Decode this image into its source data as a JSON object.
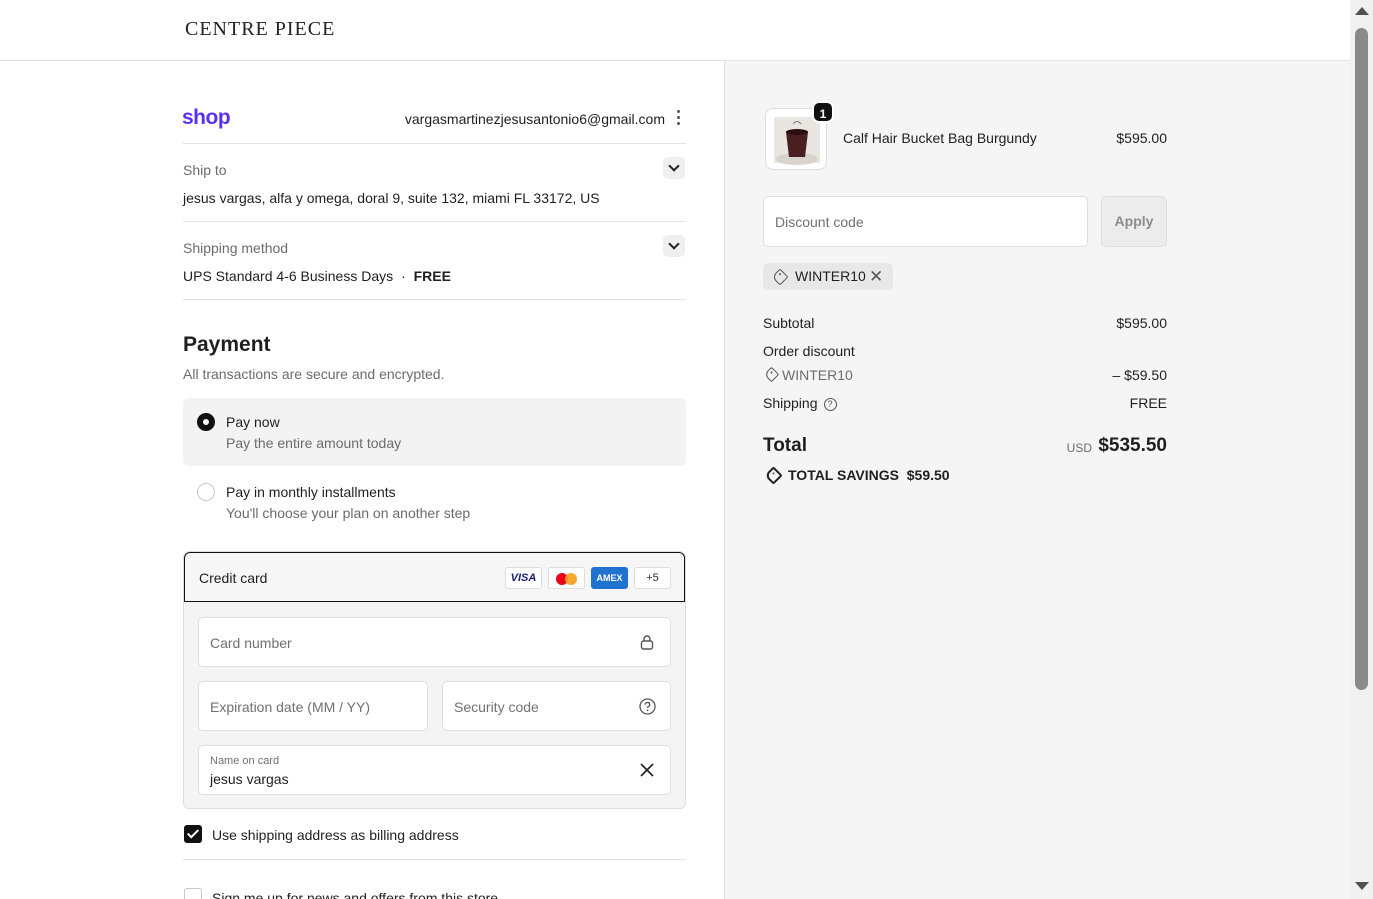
{
  "header": {
    "brand": "CENTRE PIECE"
  },
  "account": {
    "shop_logo": "shop",
    "email": "vargasmartinezjesusantonio6@gmail.com"
  },
  "ship_to": {
    "label": "Ship to",
    "address": "jesus vargas, alfa y omega, doral 9, suite 132, miami FL 33172, US"
  },
  "shipping_method": {
    "label": "Shipping method",
    "value": "UPS Standard 4-6 Business Days",
    "separator": "·",
    "price": "FREE"
  },
  "payment": {
    "title": "Payment",
    "subtitle": "All transactions are secure and encrypted.",
    "options": [
      {
        "title": "Pay now",
        "subtitle": "Pay the entire amount today",
        "selected": true
      },
      {
        "title": "Pay in monthly installments",
        "subtitle": "You'll choose your plan on another step",
        "selected": false
      }
    ],
    "credit_card": {
      "label": "Credit card",
      "logos": [
        "VISA",
        "mastercard",
        "AMEX",
        "+5"
      ],
      "card_number_placeholder": "Card number",
      "expiration_placeholder": "Expiration date (MM / YY)",
      "security_code_placeholder": "Security code",
      "name_label": "Name on card",
      "name_value": "jesus vargas"
    },
    "billing_checkbox": "Use shipping address as billing address",
    "newsletter_checkbox": "Sign me up for news and offers from this store"
  },
  "order": {
    "product": {
      "name": "Calf Hair Bucket Bag Burgundy",
      "price": "$595.00",
      "quantity": "1"
    },
    "discount_placeholder": "Discount code",
    "apply_label": "Apply",
    "applied_code": "WINTER10",
    "subtotal_label": "Subtotal",
    "subtotal_value": "$595.00",
    "order_discount_label": "Order discount",
    "discount_code": "WINTER10",
    "discount_value": "– $59.50",
    "shipping_label": "Shipping",
    "shipping_value": "FREE",
    "total_label": "Total",
    "currency": "USD",
    "total_value": "$535.50",
    "savings_text": "TOTAL SAVINGS  $59.50"
  },
  "colors": {
    "shop_purple": "#5a31f4",
    "amex_blue": "#1f72cd",
    "checkout_bg": "#f5f5f5"
  }
}
